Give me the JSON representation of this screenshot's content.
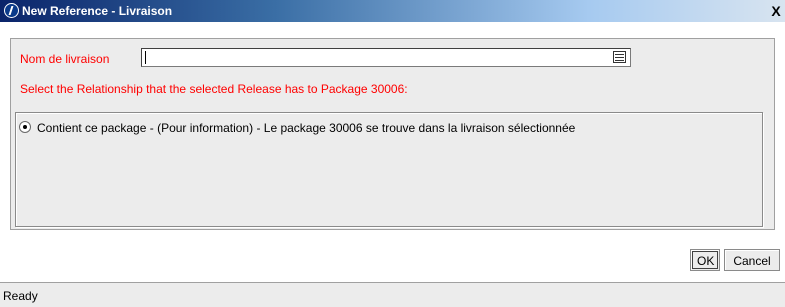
{
  "window": {
    "title": "New Reference - Livraison",
    "close_label": "X"
  },
  "form": {
    "field_label": "Nom de livraison",
    "field_value": "",
    "instruction": "Select the Relationship that the selected Release has to Package 30006:"
  },
  "relationship": {
    "options": [
      {
        "label": "Contient ce package - (Pour information) - Le package 30006 se trouve dans la livraison sélectionnée",
        "selected": true
      }
    ]
  },
  "buttons": {
    "ok_label": "OK",
    "cancel_label": "Cancel"
  },
  "status": {
    "text": "Ready"
  },
  "colors": {
    "label_red": "#ff0000",
    "titlebar_dark": "#0a246a",
    "panel_gray": "#ececec"
  }
}
